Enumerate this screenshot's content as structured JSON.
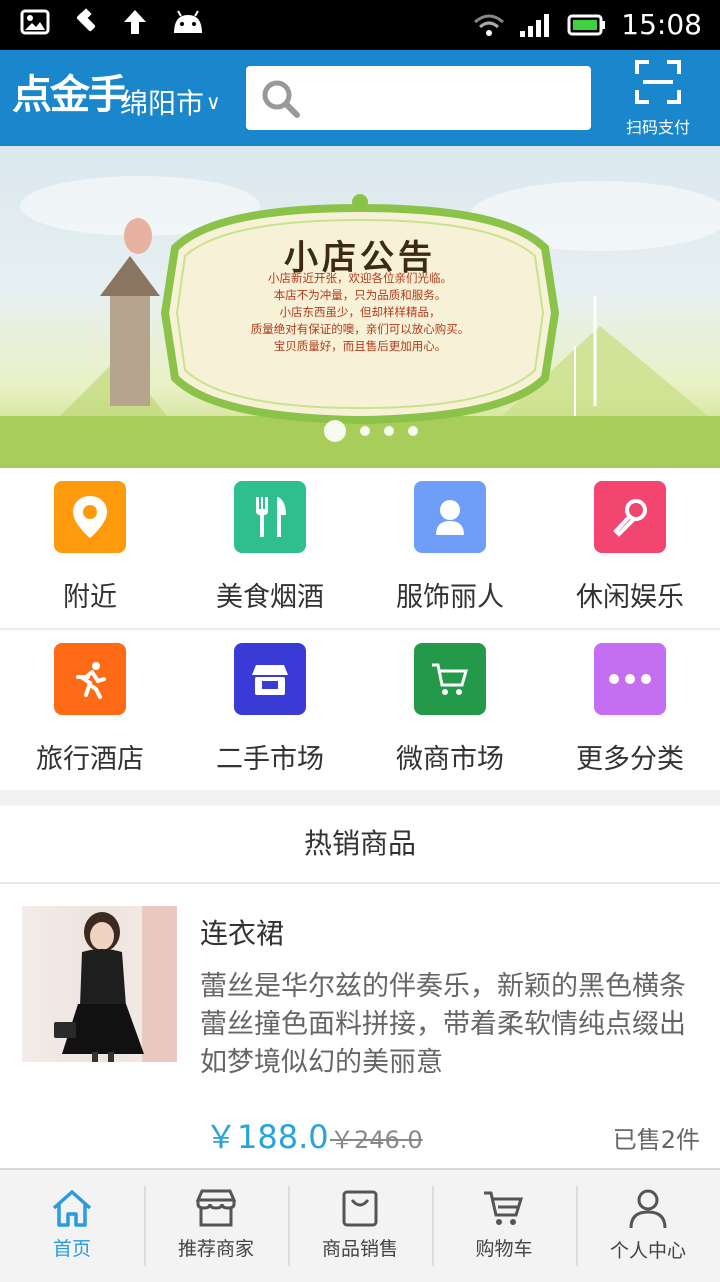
{
  "status_bar": {
    "time": "15:08"
  },
  "header": {
    "brand": "点金手",
    "city": "绵阳市",
    "search_placeholder": "",
    "scan_label": "扫码支付"
  },
  "banner": {
    "title": "小店公告",
    "lines": [
      "小店新近开张，欢迎各位亲们光临。",
      "本店不为冲量，只为品质和服务。",
      "小店东西虽少，但却样样精品，",
      "质量绝对有保证的噢，亲们可以放心购买。",
      "宝贝质量好，而且售后更加用心。"
    ],
    "slide_count": 4,
    "active_slide": 1
  },
  "categories": [
    {
      "label": "附近",
      "icon": "location-pin-icon",
      "color": "#ff9a0d"
    },
    {
      "label": "美食烟酒",
      "icon": "fork-knife-icon",
      "color": "#2fbf8f"
    },
    {
      "label": "服饰丽人",
      "icon": "person-icon",
      "color": "#6f9ef8"
    },
    {
      "label": "休闲娱乐",
      "icon": "microphone-icon",
      "color": "#f2456f"
    },
    {
      "label": "旅行酒店",
      "icon": "running-person-icon",
      "color": "#ff6a17"
    },
    {
      "label": "二手市场",
      "icon": "shop-icon",
      "color": "#3a3ad6"
    },
    {
      "label": "微商市场",
      "icon": "cart-icon",
      "color": "#24994a"
    },
    {
      "label": "更多分类",
      "icon": "more-dots-icon",
      "color": "#c46ef2"
    }
  ],
  "hot": {
    "title": "热销商品",
    "product": {
      "name": "连衣裙",
      "description": "蕾丝是华尔兹的伴奏乐，新颖的黑色横条蕾丝撞色面料拼接，带着柔软情纯点缀出如梦境似幻的美丽意",
      "price": "￥188.0",
      "old_price": "￥246.0",
      "sold": "已售2件"
    }
  },
  "bottom_nav": [
    {
      "label": "首页",
      "icon": "home-icon",
      "active": true
    },
    {
      "label": "推荐商家",
      "icon": "store-icon",
      "active": false
    },
    {
      "label": "商品销售",
      "icon": "bag-icon",
      "active": false
    },
    {
      "label": "购物车",
      "icon": "cart-icon",
      "active": false
    },
    {
      "label": "个人中心",
      "icon": "user-icon",
      "active": false
    }
  ],
  "colors": {
    "header": "#1a86cc",
    "accent": "#2b9be0",
    "price": "#28a4db"
  }
}
